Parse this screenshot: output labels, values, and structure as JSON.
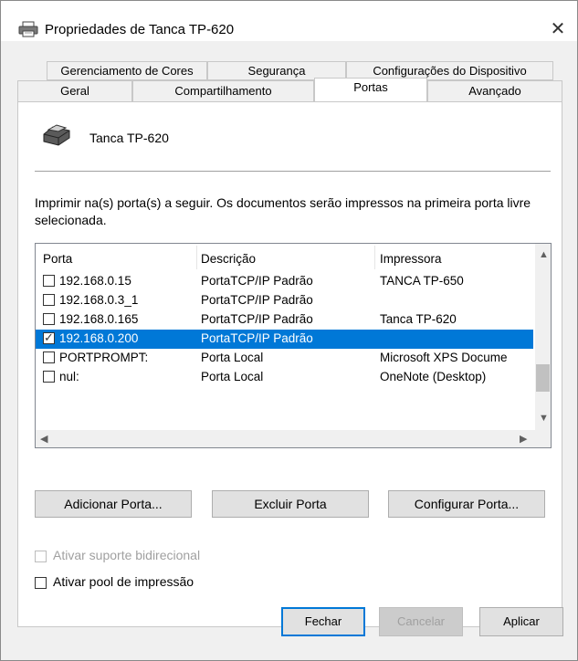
{
  "window": {
    "title": "Propriedades de Tanca TP-620",
    "close_glyph": "✕"
  },
  "tabs_row1": [
    "Gerenciamento de Cores",
    "Segurança",
    "Configurações do Dispositivo"
  ],
  "tabs_row2": [
    "Geral",
    "Compartilhamento",
    "Portas",
    "Avançado"
  ],
  "selected_tab": "Portas",
  "printer_name": "Tanca TP-620",
  "description": "Imprimir na(s) porta(s) a seguir. Os documentos serão impressos na primeira porta livre selecionada.",
  "ports_table": {
    "headers": [
      "Porta",
      "Descrição",
      "Impressora"
    ],
    "rows": [
      {
        "port": "192.168.0.15",
        "desc": "PortaTCP/IP Padrão",
        "printer": "TANCA TP-650",
        "checked": false,
        "selected": false
      },
      {
        "port": "192.168.0.3_1",
        "desc": "PortaTCP/IP Padrão",
        "printer": "",
        "checked": false,
        "selected": false
      },
      {
        "port": "192.168.0.165",
        "desc": "PortaTCP/IP Padrão",
        "printer": "Tanca TP-620",
        "checked": false,
        "selected": false
      },
      {
        "port": "192.168.0.200",
        "desc": "PortaTCP/IP Padrão",
        "printer": "",
        "checked": true,
        "selected": true
      },
      {
        "port": "PORTPROMPT:",
        "desc": "Porta Local",
        "printer": "Microsoft XPS Docume",
        "checked": false,
        "selected": false
      },
      {
        "port": "nul:",
        "desc": "Porta Local",
        "printer": "OneNote (Desktop)",
        "checked": false,
        "selected": false
      }
    ]
  },
  "buttons": {
    "add_port": "Adicionar Porta...",
    "delete_port": "Excluir Porta",
    "configure_port": "Configurar Porta..."
  },
  "options": {
    "bidirectional": {
      "label": "Ativar suporte bidirecional",
      "checked": false,
      "enabled": false
    },
    "pooling": {
      "label": "Ativar pool de impressão",
      "checked": false,
      "enabled": true
    }
  },
  "footer": {
    "close": "Fechar",
    "cancel": "Cancelar",
    "apply": "Aplicar"
  },
  "colors": {
    "selection": "#0078d7",
    "dialog_bg": "#f0f0f0",
    "panel_bg": "#ffffff"
  },
  "icons": {
    "title": "printer-icon",
    "printer": "printer-icon",
    "close": "close-icon"
  }
}
